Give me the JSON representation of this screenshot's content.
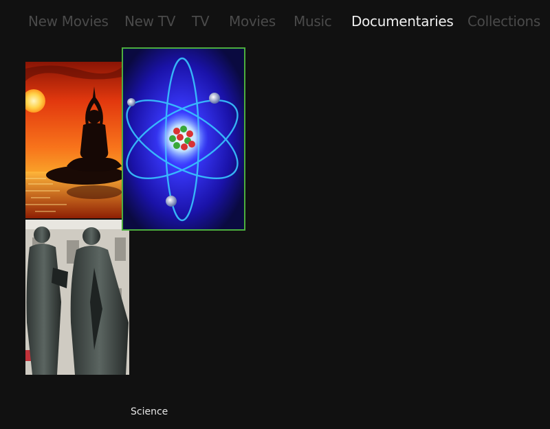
{
  "nav": {
    "items": [
      {
        "label": "New Movies"
      },
      {
        "label": "New TV"
      },
      {
        "label": "TV"
      },
      {
        "label": "Movies"
      },
      {
        "label": "Music"
      },
      {
        "label": "Documentaries"
      },
      {
        "label": "Collections"
      }
    ],
    "active": "Documentaries"
  },
  "tiles": [
    {
      "subject": "meditation silhouette at sunset"
    },
    {
      "subject": "atom with electron orbits"
    },
    {
      "subject": "bronze statues of two men"
    }
  ],
  "focused_item": {
    "title": "Science"
  },
  "colors": {
    "background": "#111111",
    "nav_inactive": "#4a4a4a",
    "nav_active": "#efefef",
    "focus_border": "#4caf3f"
  }
}
